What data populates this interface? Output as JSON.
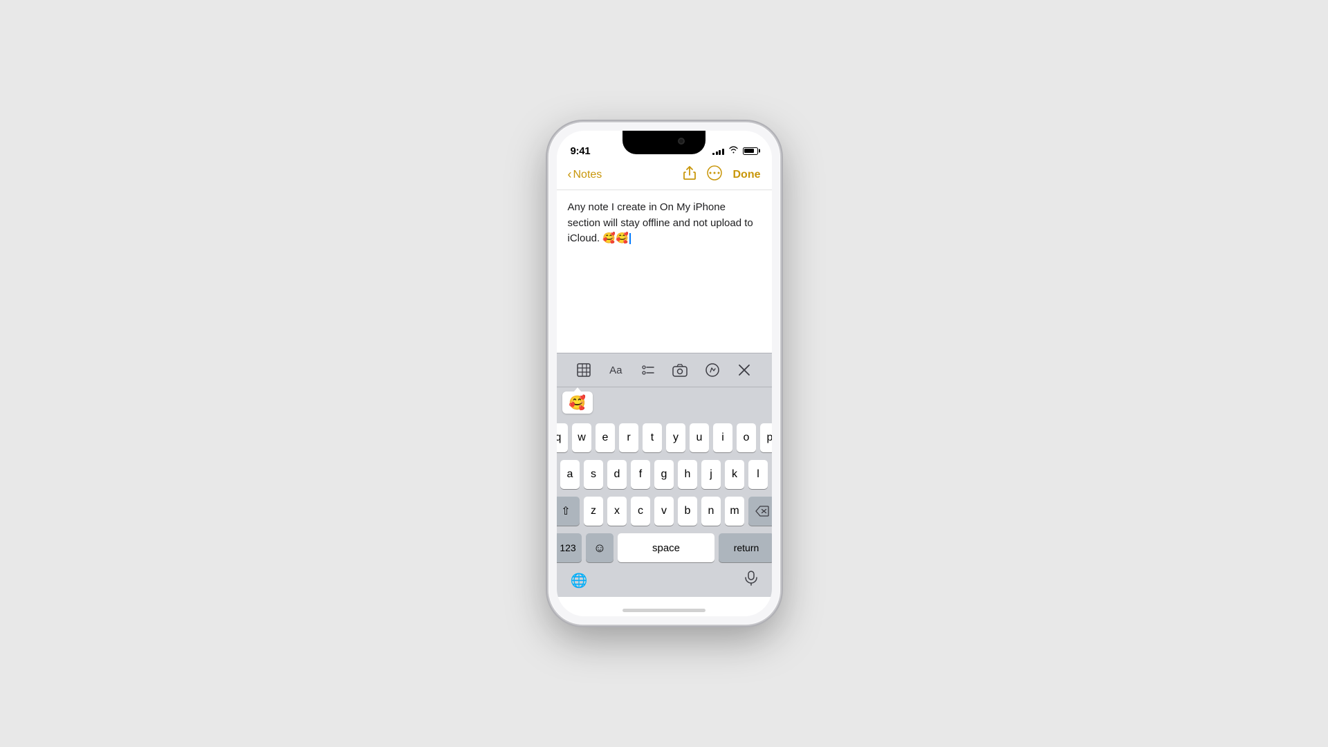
{
  "app": {
    "title": "Notes"
  },
  "status_bar": {
    "time": "9:41",
    "signal_bars": [
      3,
      5,
      7,
      9,
      11
    ],
    "battery_percent": 85
  },
  "nav": {
    "back_label": "Notes",
    "done_label": "Done"
  },
  "note": {
    "content": "Any note I create in On My iPhone section will stay offline and not upload to iCloud. 🥰🥰"
  },
  "emoji_suggestion": {
    "emoji": "🥰",
    "label": "smiling face with hearts"
  },
  "toolbar": {
    "table_icon": "⊞",
    "format_icon": "Aa",
    "list_icon": "≡",
    "camera_icon": "📷",
    "markup_icon": "✏",
    "close_icon": "✕"
  },
  "keyboard": {
    "rows": [
      [
        "q",
        "w",
        "e",
        "r",
        "t",
        "y",
        "u",
        "i",
        "o",
        "p"
      ],
      [
        "a",
        "s",
        "d",
        "f",
        "g",
        "h",
        "j",
        "k",
        "l"
      ],
      [
        "⇧",
        "z",
        "x",
        "c",
        "v",
        "b",
        "n",
        "m",
        "⌫"
      ],
      [
        "123",
        "😊",
        "space",
        "return"
      ]
    ],
    "space_label": "space",
    "return_label": "return",
    "numbers_label": "123",
    "shift_label": "⇧",
    "backspace_label": "⌫",
    "globe_icon": "🌐",
    "mic_icon": "🎤"
  }
}
